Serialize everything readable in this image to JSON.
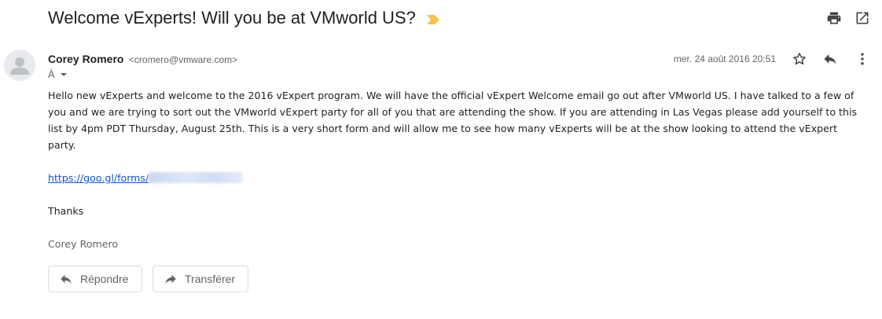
{
  "email": {
    "subject": "Welcome vExperts! Will you be at VMworld US?",
    "sender_name": "Corey Romero",
    "sender_email": "<cromero@vmware.com>",
    "recipient_label": "À",
    "date": "mer. 24 août 2016 20:51",
    "body_paragraph": "Hello new vExperts and welcome to the 2016 vExpert program. We will have the official vExpert Welcome email go out after VMworld US. I have talked to a few of you and we are trying to sort out the VMworld vExpert party for all of you that are attending the show. If you are attending in Las Vegas please add yourself to this list by 4pm PDT Thursday, August 25th. This is a very short form and will allow me to see how many vExperts will be at the show looking to attend the vExpert party.",
    "link_text": "https://goo.gl/forms/",
    "thanks": "Thanks",
    "signature": "Corey Romero"
  },
  "actions": {
    "reply_label": "Répondre",
    "forward_label": "Transférer"
  },
  "icons": {
    "importance": "importance-marker-icon",
    "print": "print-icon",
    "open_new_window": "open-in-new-window-icon",
    "star": "star-icon",
    "reply": "reply-icon",
    "more": "more-vert-icon",
    "avatar": "default-avatar-icon",
    "forward": "forward-icon"
  },
  "colors": {
    "importance": "#f6c344",
    "link": "#1155cc",
    "text": "#222222",
    "muted": "#5f6368"
  }
}
